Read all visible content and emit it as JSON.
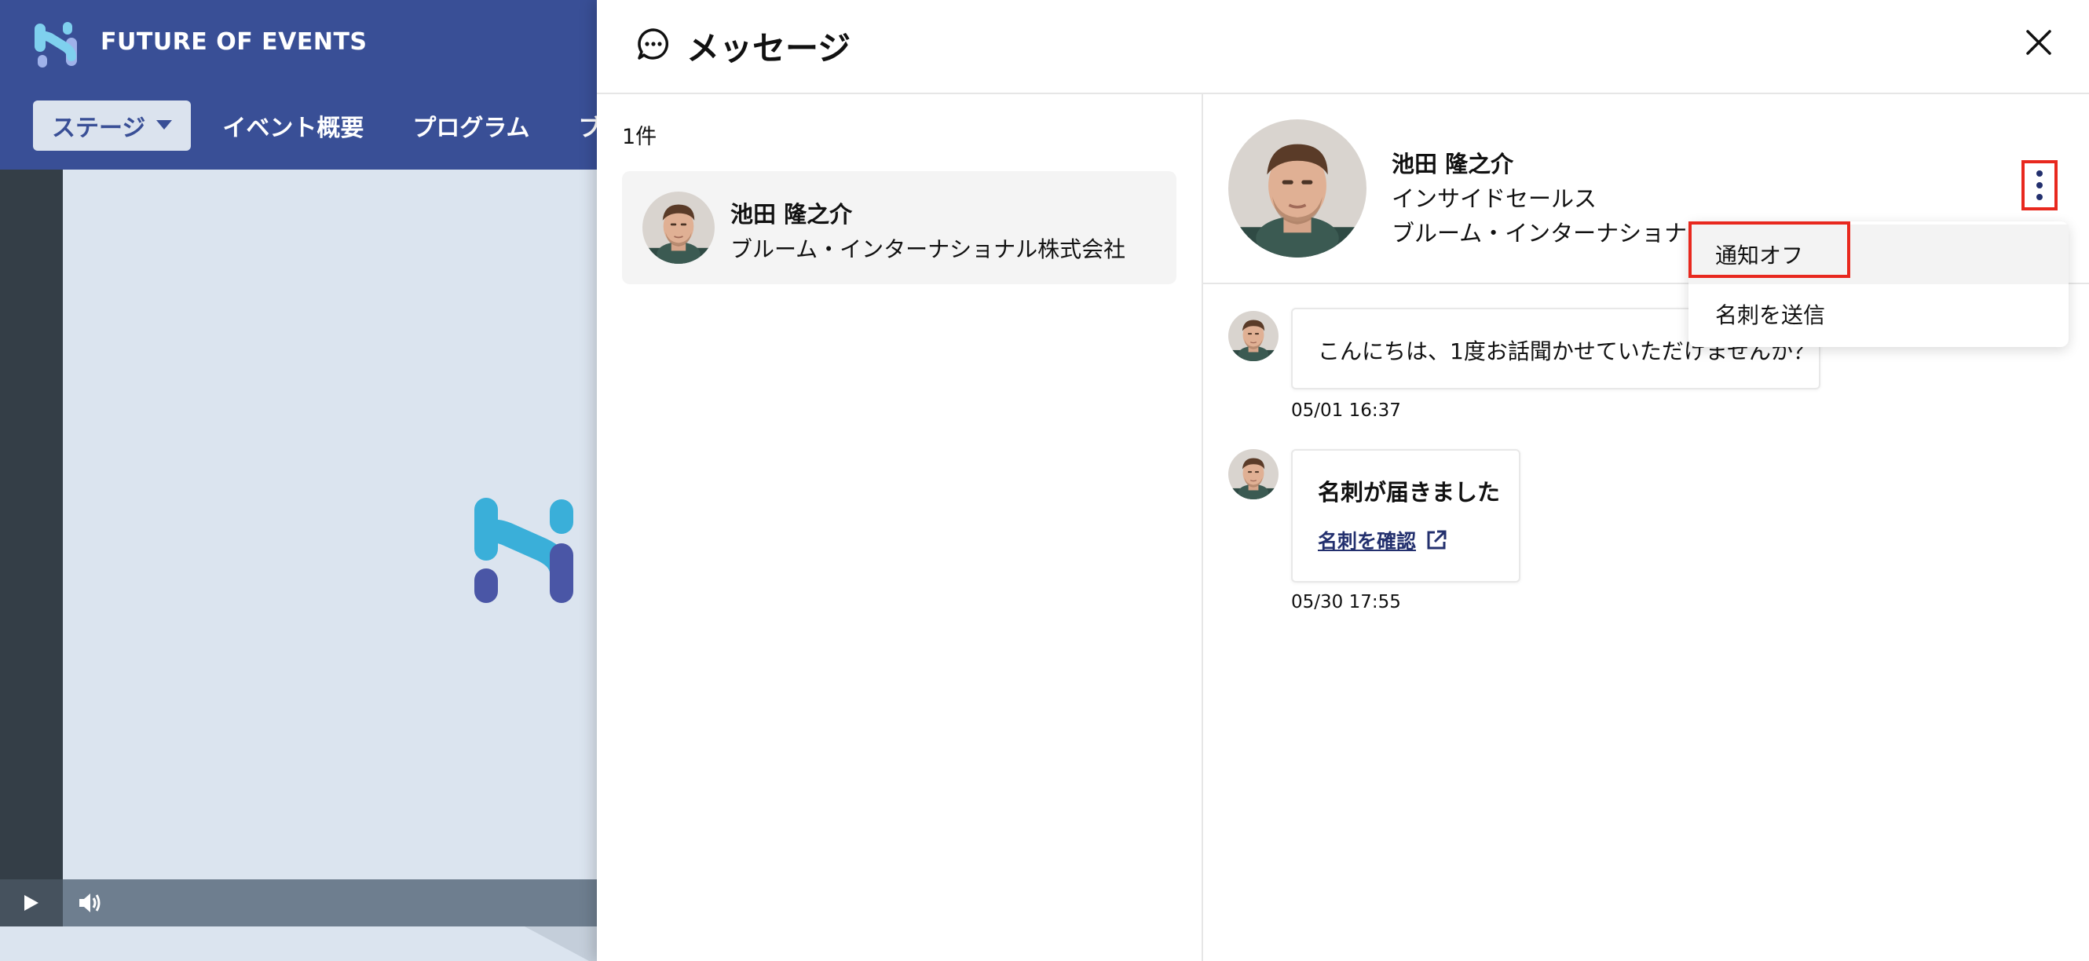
{
  "app": {
    "brand_name": "FUTURE OF EVENTS",
    "nav": {
      "stage_label": "ステージ",
      "links": [
        "イベント概要",
        "プログラム",
        "ブー"
      ]
    }
  },
  "drawer": {
    "title": "メッセージ",
    "conversation_count": "1件",
    "conversations": [
      {
        "name": "池田 隆之介",
        "company": "ブルーム・インターナショナル株式会社"
      }
    ]
  },
  "chat": {
    "contact": {
      "name": "池田 隆之介",
      "role": "インサイドセールス",
      "company": "ブルーム・インターナショナル株式会社"
    },
    "menu": {
      "items": [
        "通知オフ",
        "名刺を送信"
      ]
    },
    "messages": [
      {
        "text": "こんにちは、1度お話聞かせていただけませんか？",
        "timestamp": "05/01 16:37"
      },
      {
        "card_title": "名刺が届きました",
        "link_label": "名刺を確認",
        "timestamp": "05/30 17:55"
      }
    ]
  },
  "colors": {
    "header_bg": "#394f96",
    "accent": "#23306e",
    "highlight": "#e8281e",
    "logo_light": "#3aafd9",
    "logo_dark": "#4a56a6"
  }
}
